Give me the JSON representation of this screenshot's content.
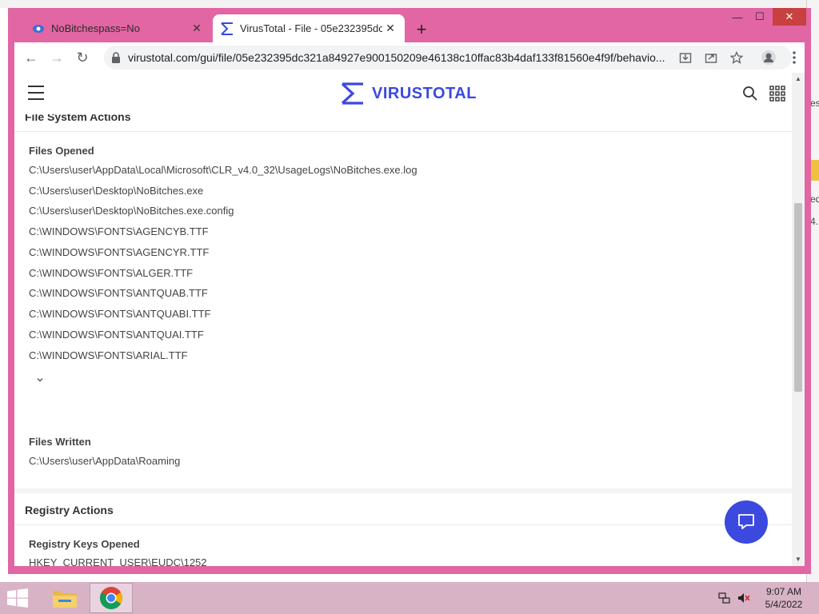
{
  "desktop": {
    "right_fragments": [
      "es",
      "ed",
      "4."
    ]
  },
  "tabs": [
    {
      "title": "NoBitchespass=No",
      "close": "✕"
    },
    {
      "title": "VirusTotal - File - 05e232395dc3",
      "close": "✕"
    }
  ],
  "new_tab": "+",
  "window_controls": {
    "minimize": "—",
    "maximize": "☐",
    "close": "✕"
  },
  "toolbar": {
    "back": "←",
    "forward": "→",
    "reload": "↻",
    "url": "virustotal.com/gui/file/05e232395dc321a84927e900150209e46138c10ffac83b4daf133f81560e4f9f/behavio..."
  },
  "site": {
    "logo_text": "VIRUSTOTAL"
  },
  "file_system_actions": {
    "title": "File System Actions",
    "files_opened": {
      "label": "Files Opened",
      "items": [
        "C:\\Users\\user\\AppData\\Local\\Microsoft\\CLR_v4.0_32\\UsageLogs\\NoBitches.exe.log",
        "C:\\Users\\user\\Desktop\\NoBitches.exe",
        "C:\\Users\\user\\Desktop\\NoBitches.exe.config",
        "C:\\WINDOWS\\FONTS\\AGENCYB.TTF",
        "C:\\WINDOWS\\FONTS\\AGENCYR.TTF",
        "C:\\WINDOWS\\FONTS\\ALGER.TTF",
        "C:\\WINDOWS\\FONTS\\ANTQUAB.TTF",
        "C:\\WINDOWS\\FONTS\\ANTQUABI.TTF",
        "C:\\WINDOWS\\FONTS\\ANTQUAI.TTF",
        "C:\\WINDOWS\\FONTS\\ARIAL.TTF"
      ],
      "expand_icon": "⌄"
    },
    "files_written": {
      "label": "Files Written",
      "items": [
        "C:\\Users\\user\\AppData\\Roaming"
      ]
    }
  },
  "registry_actions": {
    "title": "Registry Actions",
    "keys_opened": {
      "label": "Registry Keys Opened",
      "items": [
        "HKEY_CURRENT_USER\\EUDC\\1252"
      ]
    }
  },
  "taskbar": {
    "time": "9:07 AM",
    "date": "5/4/2022"
  },
  "colors": {
    "window_frame": "#e166a3",
    "brand": "#3b49df",
    "taskbar": "#d8b3c6",
    "close": "#c84040"
  }
}
